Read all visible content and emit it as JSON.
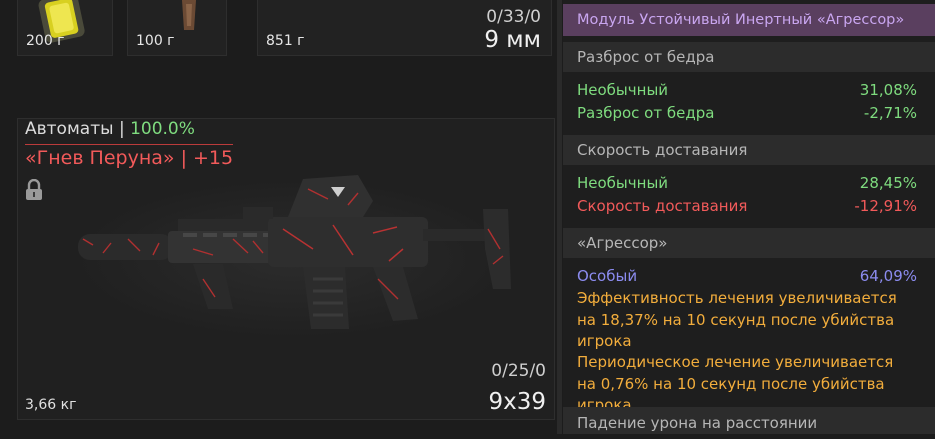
{
  "slots": [
    {
      "weight": "200 г",
      "icon": "yellow-item-icon"
    },
    {
      "weight": "100 г",
      "icon": "brown-item-icon"
    },
    {
      "weight": "851 г",
      "ammo": "0/33/0",
      "caliber": "9 мм"
    }
  ],
  "weapon": {
    "category": "Автоматы",
    "separator": "|",
    "percent": "100.0%",
    "skin": "«Гнев Перуна» | +15",
    "weight": "3,66 кг",
    "magazine": "0/25/0",
    "caliber": "9x39",
    "icon": "lock-icon"
  },
  "panel": {
    "title": "Модуль Устойчивый Инертный «Агрессор»",
    "sections": [
      {
        "header": "Разброс от бедра",
        "rows": [
          {
            "label": "Необычный",
            "value": "31,08%",
            "color": "green"
          },
          {
            "label": "Разброс от бедра",
            "value": "-2,71%",
            "color": "green"
          }
        ]
      },
      {
        "header": "Скорость доставания",
        "rows": [
          {
            "label": "Необычный",
            "value": "28,45%",
            "color": "green"
          },
          {
            "label": "Скорость доставания",
            "value": "-12,91%",
            "color": "red"
          }
        ]
      },
      {
        "header": "«Агрессор»",
        "rows": [
          {
            "label": "Особый",
            "value": "64,09%",
            "color": "blue"
          }
        ],
        "descriptions": [
          "Эффективность лечения увеличивается на 18,37% на 10 секунд после убийства игрока",
          "Периодическое лечение увеличивается на 0,76% на 10 секунд после убийства игрока"
        ]
      },
      {
        "header": "Падение урона на расстоянии"
      }
    ]
  },
  "colors": {
    "green": "#7fdc7f",
    "red": "#f25a5a",
    "blue": "#8c8cf0",
    "orange": "#f2ad3c",
    "title_bg": "#5a3f5f",
    "title_text": "#c9a6f0"
  }
}
